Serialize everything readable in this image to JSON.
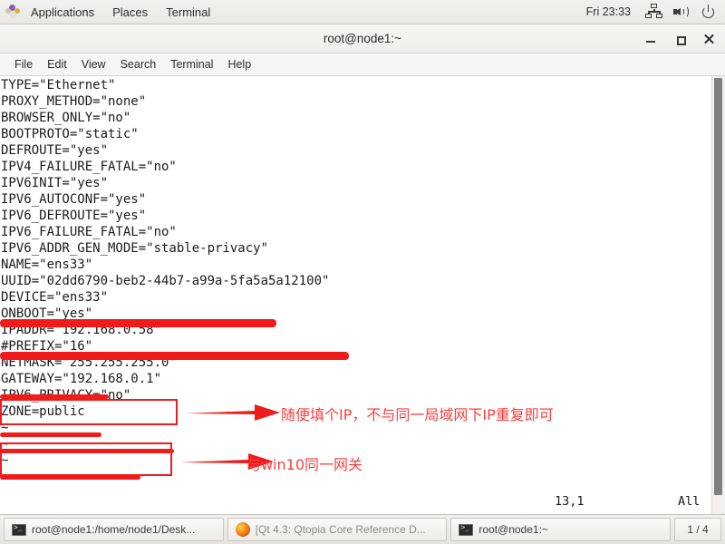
{
  "top_panel": {
    "app_icon": "applications-icon",
    "menus": [
      "Applications",
      "Places",
      "Terminal"
    ],
    "clock": "Fri 23:33",
    "tray": [
      "network-icon",
      "volume-icon",
      "power-icon"
    ]
  },
  "window": {
    "title": "root@node1:~",
    "buttons": {
      "minimize": "minimize-button",
      "maximize": "maximize-button",
      "close": "close-button"
    },
    "menubar": [
      "File",
      "Edit",
      "View",
      "Search",
      "Terminal",
      "Help"
    ]
  },
  "terminal": {
    "lines": [
      "TYPE=\"Ethernet\"",
      "PROXY_METHOD=\"none\"",
      "BROWSER_ONLY=\"no\"",
      "BOOTPROTO=\"static\"",
      "DEFROUTE=\"yes\"",
      "IPV4_FAILURE_FATAL=\"no\"",
      "IPV6INIT=\"yes\"",
      "IPV6_AUTOCONF=\"yes\"",
      "IPV6_DEFROUTE=\"yes\"",
      "IPV6_FAILURE_FATAL=\"no\"",
      "IPV6_ADDR_GEN_MODE=\"stable-privacy\"",
      "NAME=\"ens33\"",
      "UUID=\"02dd6790-beb2-44b7-a99a-5fa5a5a12100\"",
      "DEVICE=\"ens33\"",
      "ONBOOT=\"yes\"",
      "IPADDR=\"192.168.0.58\"",
      "#PREFIX=\"16\"",
      "NETMASK=\"255.255.255.0\"",
      "GATEWAY=\"192.168.0.1\"",
      "IPV6_PRIVACY=\"no\"",
      "ZONE=public",
      "~",
      "~",
      "~",
      "~"
    ],
    "status_position": "13,1",
    "status_scroll": "All"
  },
  "annotations": {
    "color": "#ee1c1c",
    "notes": [
      {
        "text": "随便填个IP，不与同一局域网下IP重复即可",
        "target": "IPADDR"
      },
      {
        "text": "与win10同一网关",
        "target": "GATEWAY"
      }
    ],
    "redacted_lines": [
      "IPV6_ADDR_GEN_MODE",
      "UUID",
      "ONBOOT",
      "#PREFIX",
      "NETMASK",
      "IPV6_PRIVACY"
    ],
    "highlight_boxes": [
      "IPADDR",
      "NETMASK+GATEWAY"
    ]
  },
  "taskbar": {
    "items": [
      {
        "icon": "terminal-icon",
        "label": "root@node1:/home/node1/Desk..."
      },
      {
        "icon": "firefox-icon",
        "label": "[Qt 4.3: Qtopia Core Reference D..."
      },
      {
        "icon": "terminal-icon",
        "label": "root@node1:~"
      }
    ],
    "workspace": "1 / 4"
  }
}
